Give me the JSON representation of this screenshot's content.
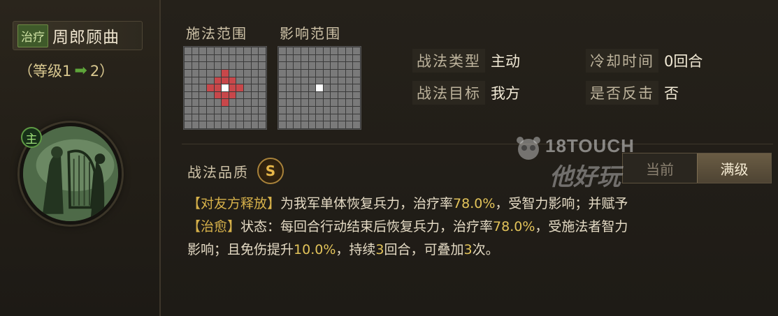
{
  "left": {
    "type_badge": "治疗",
    "skill_name": "周郎顾曲",
    "level_open": "（等级1",
    "level_arrow": "➡",
    "level_close": "2）",
    "active_marker": "主"
  },
  "ranges": {
    "cast_label": "施法范围",
    "effect_label": "影响范围",
    "grid_size": 11,
    "cast_red_cells": [
      [
        3,
        5
      ],
      [
        4,
        4
      ],
      [
        4,
        5
      ],
      [
        4,
        6
      ],
      [
        5,
        3
      ],
      [
        5,
        4
      ],
      [
        5,
        6
      ],
      [
        5,
        7
      ],
      [
        6,
        4
      ],
      [
        6,
        5
      ],
      [
        6,
        6
      ],
      [
        7,
        5
      ]
    ],
    "cast_center": [
      5,
      5
    ],
    "effect_center": [
      5,
      5
    ]
  },
  "info": {
    "type_key": "战法类型",
    "type_val": "主动",
    "cooldown_key": "冷却时间",
    "cooldown_val": "0回合",
    "target_key": "战法目标",
    "target_val": "我方",
    "counter_key": "是否反击",
    "counter_val": "否"
  },
  "quality": {
    "label": "战法品质",
    "grade": "S"
  },
  "toggle": {
    "current_label": "当前",
    "max_label": "满级"
  },
  "watermark": {
    "latin": "18TOUCH",
    "cn": "他好玩"
  },
  "description": {
    "l1_tag": "【对友方释放】",
    "l1_text_a": "为我军单体恢复兵力，治疗率",
    "l1_num": "78.0%",
    "l1_text_b": "，受智力影响；并赋予",
    "l2_tag": "【治愈】",
    "l2_text_a": "状态：每回合行动结束后恢复兵力，治疗率",
    "l2_num": "78.0%",
    "l2_text_b": "，受施法者智力",
    "l3_text_a": "影响；且免伤提升",
    "l3_num1": "10.0%",
    "l3_text_b": "，持续",
    "l3_num2": "3",
    "l3_text_c": "回合，可叠加",
    "l3_num3": "3",
    "l3_text_d": "次。"
  },
  "colors": {
    "accent_gold": "#d6b14a",
    "range_red": "#c8474a",
    "heal_green": "#3f5a2a"
  }
}
